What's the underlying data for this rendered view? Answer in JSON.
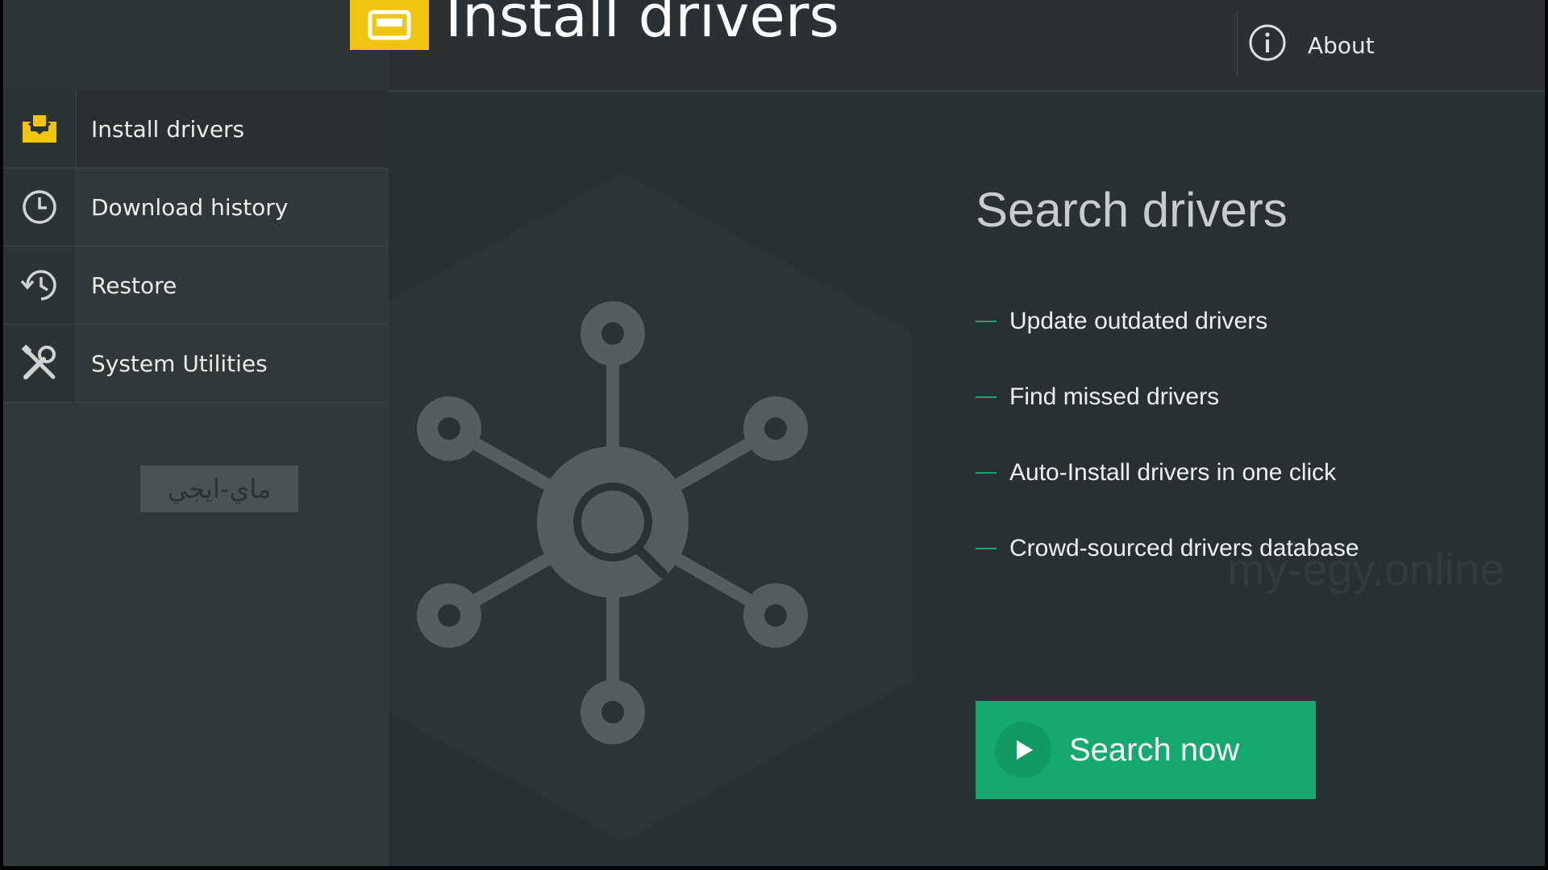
{
  "header": {
    "title": "Install drivers",
    "about_label": "About"
  },
  "sidebar": {
    "items": [
      {
        "label": "Install drivers",
        "icon": "tray-icon"
      },
      {
        "label": "Download history",
        "icon": "clock-icon"
      },
      {
        "label": "Restore",
        "icon": "history-icon"
      },
      {
        "label": "System Utilities",
        "icon": "tools-icon"
      }
    ],
    "watermark_tag": "ماي-ايجي"
  },
  "main": {
    "search_title": "Search drivers",
    "features": [
      "Update outdated drivers",
      "Find missed drivers",
      "Auto-Install drivers in one click",
      "Crowd-sourced drivers database"
    ],
    "search_button": "Search now",
    "watermark": "my-egy.online"
  },
  "colors": {
    "accent_yellow": "#f1c40f",
    "accent_green": "#16a96d",
    "background": "#283033"
  }
}
